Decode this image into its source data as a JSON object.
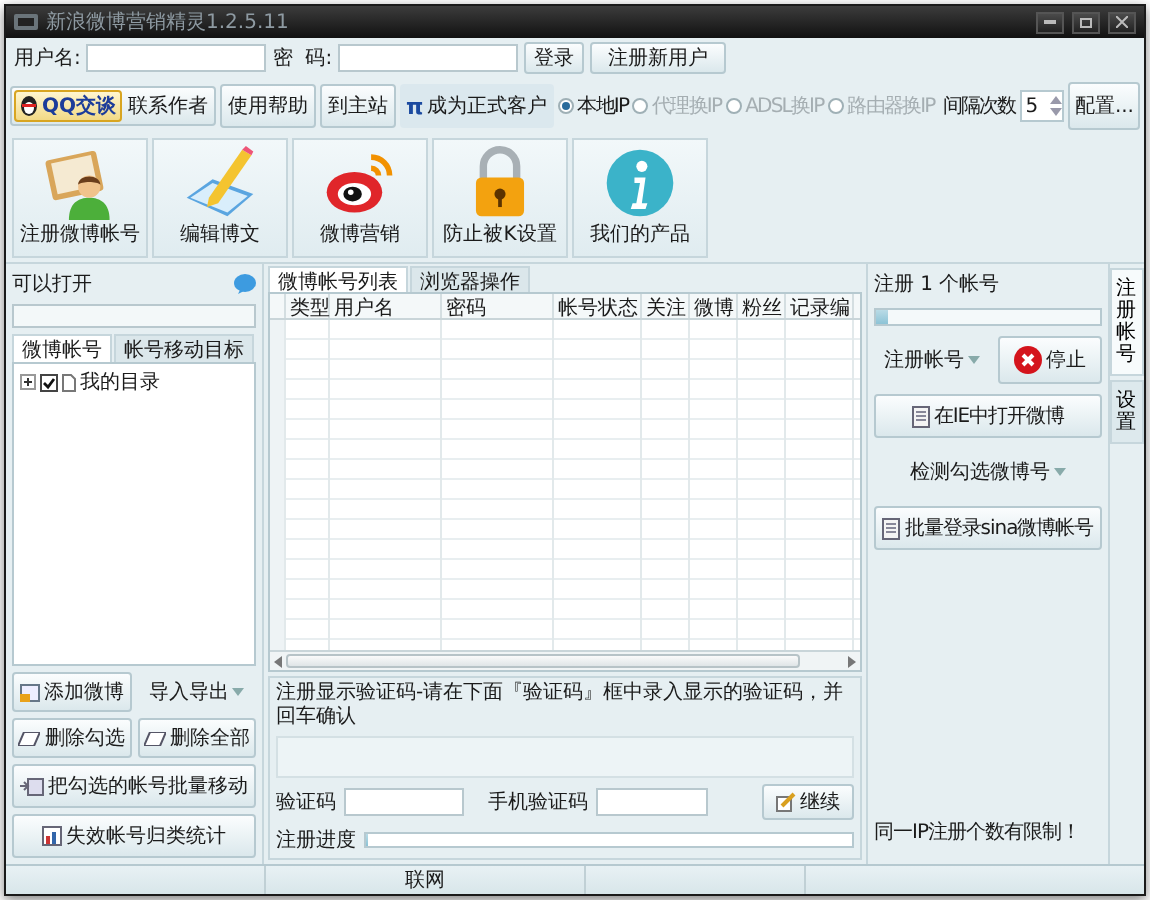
{
  "window": {
    "title": "新浪微博营销精灵1.2.5.11"
  },
  "login": {
    "username_label": "用户名:",
    "password_label": "密  码:",
    "login_button": "登录",
    "register_button": "注册新用户"
  },
  "toolbar": {
    "qq_button": "QQ交谈",
    "contact_button": "联系作者",
    "buttons": [
      {
        "kind": "plain",
        "label": "使用帮助"
      },
      {
        "kind": "plain",
        "label": "到主站"
      },
      {
        "kind": "pi",
        "glyph": "π",
        "label": "成为正式客户"
      }
    ]
  },
  "ip_modes": [
    {
      "label": "本地IP",
      "selected": true,
      "disabled": false
    },
    {
      "label": "代理换IP",
      "selected": false,
      "disabled": true
    },
    {
      "label": "ADSL换IP",
      "selected": false,
      "disabled": true
    },
    {
      "label": "路由器换IP",
      "selected": false,
      "disabled": true
    }
  ],
  "interval": {
    "label": "间隔次数",
    "value": "5"
  },
  "config_button": "配置...",
  "tools": [
    {
      "kind": "contacts",
      "label": "注册微博帐号"
    },
    {
      "kind": "edit",
      "label": "编辑博文"
    },
    {
      "kind": "weibo",
      "label": "微博营销"
    },
    {
      "kind": "lock",
      "label": "防止被K设置"
    },
    {
      "kind": "info",
      "label": "我们的产品"
    }
  ],
  "left_panel": {
    "title": "可以打开",
    "tabs": [
      {
        "label": "微博帐号",
        "selected": true
      },
      {
        "label": "帐号移动目标",
        "selected": false
      }
    ],
    "tree": [
      {
        "label": "我的目录",
        "checked": true,
        "expanded": false
      }
    ],
    "buttons": [
      {
        "kind": "add",
        "label": "添加微博"
      },
      {
        "kind": "dropdown",
        "label": "导入导出"
      },
      {
        "kind": "erase",
        "label": "删除勾选"
      },
      {
        "kind": "erase",
        "label": "删除全部"
      },
      {
        "kind": "move",
        "label": "把勾选的帐号批量移动"
      },
      {
        "kind": "stats",
        "label": "失效帐号归类统计"
      }
    ]
  },
  "center": {
    "tabs": [
      {
        "label": "微博帐号列表",
        "selected": true
      },
      {
        "label": "浏览器操作",
        "selected": false
      }
    ],
    "table": {
      "columns": [
        "类型",
        "用户名",
        "密码",
        "帐号状态",
        "关注",
        "微博",
        "粉丝",
        "记录编"
      ]
    },
    "captcha": {
      "legend": "注册显示验证码-请在下面『验证码』框中录入显示的验证码，并回车确认",
      "code_label": "验证码",
      "phone_label": "手机验证码",
      "continue_button": "继续",
      "progress_label": "注册进度",
      "progress": {
        "level": 0
      }
    }
  },
  "right_panel": {
    "count_label": "注册 1 个帐号",
    "progress": {
      "level": 0.05
    },
    "buttons": [
      {
        "kind": "dropdown",
        "label": "注册帐号"
      },
      {
        "kind": "stop",
        "label": "停止"
      },
      {
        "kind": "ie",
        "label": "在IE中打开微博"
      },
      {
        "kind": "dropdown",
        "label": "检测勾选微博号"
      },
      {
        "kind": "batch",
        "label": "批量登录sina微博帐号"
      }
    ],
    "note": "同一IP注册个数有限制！"
  },
  "side_tabs": [
    {
      "label": "注册帐号",
      "selected": true
    },
    {
      "label": "设置",
      "selected": false
    }
  ],
  "status_bar": {
    "segments": [
      "联网"
    ]
  }
}
